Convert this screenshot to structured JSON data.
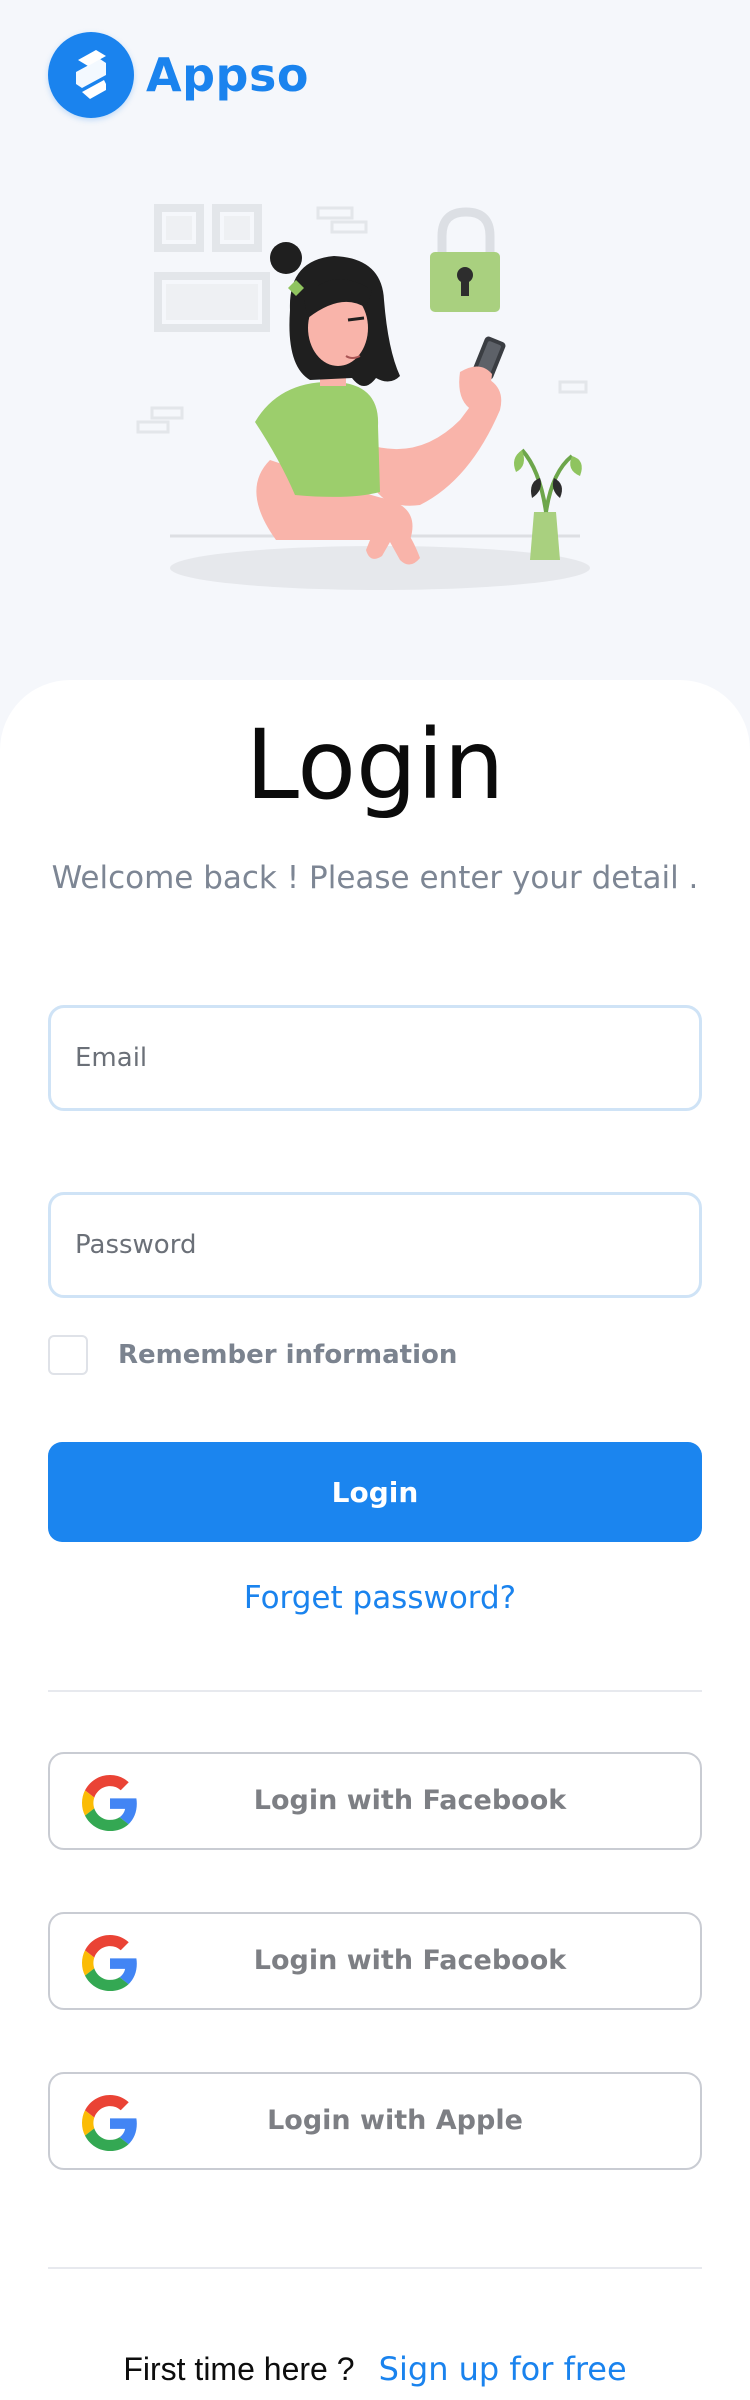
{
  "brand": {
    "name": "Appso",
    "logo_icon": "appso-logo-icon",
    "color": "#1a83ee"
  },
  "illustration": {
    "name": "woman-with-phone-illustration"
  },
  "login": {
    "title": "Login",
    "subtitle": "Welcome back ! Please enter your detail .",
    "email_placeholder": "Email",
    "password_placeholder": "Password",
    "remember_label": "Remember information",
    "remember_checked": false,
    "login_button": "Login",
    "forget_link": "Forget password?"
  },
  "social": [
    {
      "label": "Login with Facebook",
      "icon": "google-icon"
    },
    {
      "label": "Login with Facebook",
      "icon": "google-icon"
    },
    {
      "label": "Login with Apple",
      "icon": "google-icon"
    }
  ],
  "footer": {
    "question": "First time here ?",
    "signup": "Sign up for free"
  },
  "colors": {
    "accent": "#1b85ef",
    "muted_text": "#7d8694",
    "field_border": "#cfe3f6"
  }
}
